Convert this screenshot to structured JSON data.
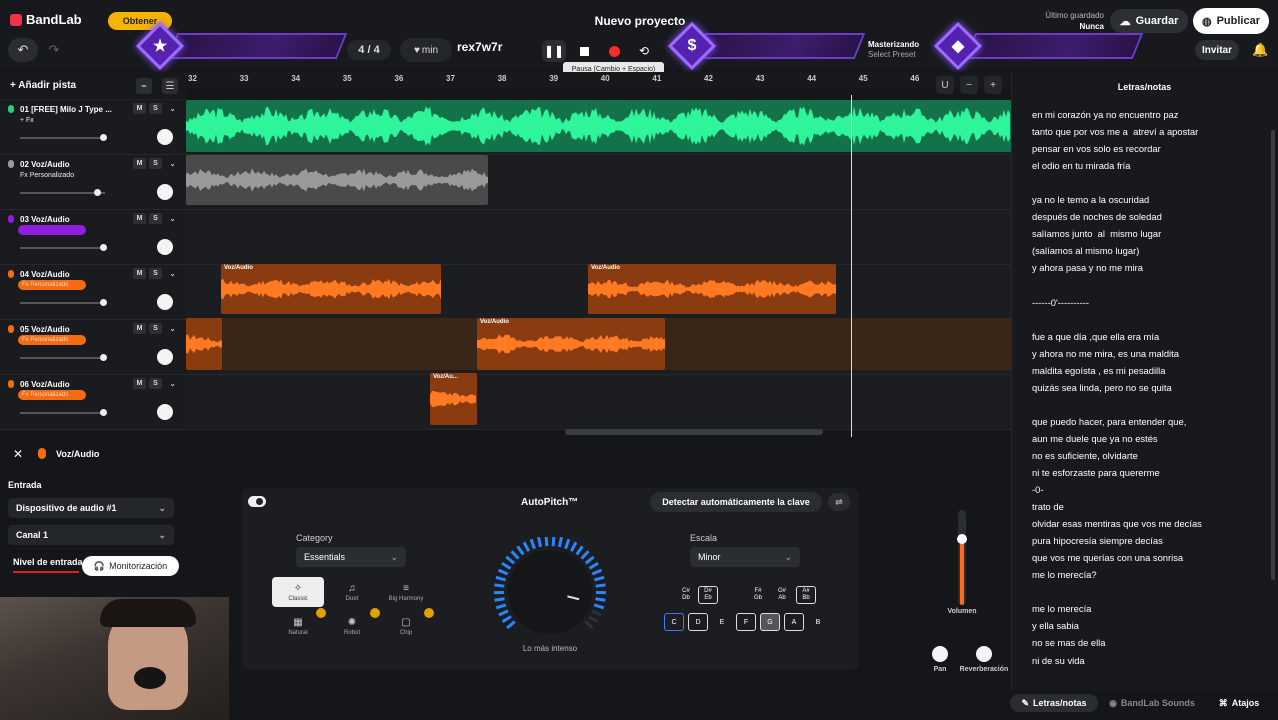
{
  "header": {
    "logo": "BandLab",
    "obtener": "Obtener",
    "project_title": "Nuevo proyecto",
    "saved_label": "Último guardado",
    "saved_value": "Nunca",
    "guardar": "Guardar",
    "publicar": "Publicar",
    "invitar": "Invitar"
  },
  "transport": {
    "time_signature": "4 / 4",
    "tempo_unit": "min",
    "key_name": "rex7w7r",
    "tooltip": "Pausa (Cambio + Espacio)",
    "mastering": "Masterizando",
    "preset": "Select Preset",
    "record_color": "#ff2a2a"
  },
  "tracks_header": {
    "add_track": "Añadir pista"
  },
  "ruler": {
    "bars": [
      "32",
      "33",
      "34",
      "35",
      "36",
      "37",
      "38",
      "39",
      "40",
      "41",
      "42",
      "43",
      "44",
      "45",
      "46"
    ]
  },
  "tracks": [
    {
      "name": "01 [FREE] Milo J Type ...",
      "fx": "+ Fx",
      "color": "#26d07c",
      "fader": 0.98,
      "pill": false
    },
    {
      "name": "02 Voz/Audio",
      "fx": "Fx Personalizado",
      "color": "#9a9a9a",
      "fader": 0.9,
      "pill": false
    },
    {
      "name": "03 Voz/Audio",
      "fx": "",
      "color": "#8e1fe0",
      "fader": 0.98,
      "pill": true
    },
    {
      "name": "04 Voz/Audio",
      "fx": "Fx Personalizado",
      "color": "#f36b12",
      "fader": 0.98,
      "pill": true
    },
    {
      "name": "05 Voz/Audio",
      "fx": "Fx Personalizado",
      "color": "#f36b12",
      "fader": 0.98,
      "pill": true
    },
    {
      "name": "06 Voz/Audio",
      "fx": "Fx Personalizado",
      "color": "#f36b12",
      "fader": 0.98,
      "pill": true
    }
  ],
  "track_buttons": {
    "mute": "M",
    "solo": "S"
  },
  "clips": {
    "label": "Voz/Audio",
    "short_label": "Voz/Au..."
  },
  "lyrics": {
    "title": "Letras/notas",
    "text": "en mi corazón ya no encuentro paz\ntanto que por vos me a  atreví a apostar\npensar en vos solo es recordar\nel odio en tu mirada fría\n\nya no le temo a la oscuridad\ndespués de noches de soledad\nsalíamos junto  al  mismo lugar\n(salíamos al mismo lugar)\ny ahora pasa y no me mira\n\n------0'----------\n\nfue a que día ,que ella era mía\ny ahora no me mira, es una maldita\nmaldita egoísta , es mi pesadilla\nquizás sea linda, pero no se quita\n\nque puedo hacer, para entender que,\naun me duele que ya no estés\nno es suficiente, olvidarte\nni te esforzaste para quererme\n-0-\ntrato de\nolvidar esas mentiras que vos me decías\npura hipocresía siempre decías\nque vos me querías con una sonrisa\nme lo merecía?\n\nme lo merecía\ny ella sabia\nno se mas de ella\nni de su vida"
  },
  "bottom_tabs": {
    "lyrics": "Letras/notas",
    "sounds": "BandLab Sounds",
    "shortcuts": "Atajos"
  },
  "input_panel": {
    "title": "Voz/Audio",
    "input_label": "Entrada",
    "device": "Dispositivo de audio #1",
    "channel": "Canal 1",
    "level_label": "Nivel de entrada",
    "monitor": "Monitorización"
  },
  "autopitch": {
    "title": "AutoPitch™",
    "detect": "Detectar automáticamente la clave",
    "category_label": "Category",
    "category_value": "Essentials",
    "styles": [
      "Classic",
      "Duet",
      "Big Harmony",
      "Natural",
      "Robot",
      "Chip"
    ],
    "dial_label": "Lo más intenso",
    "scale_label": "Escala",
    "scale_value": "Minor",
    "sharps": [
      {
        "top": "C#",
        "bottom": "Db",
        "on": false
      },
      {
        "top": "D#",
        "bottom": "Eb",
        "on": true
      },
      {
        "top": "F#",
        "bottom": "Gb",
        "on": false
      },
      {
        "top": "G#",
        "bottom": "Ab",
        "on": false
      },
      {
        "top": "A#",
        "bottom": "Bb",
        "on": true
      }
    ],
    "naturals": [
      {
        "k": "C",
        "on": true,
        "accent": true
      },
      {
        "k": "D",
        "on": true,
        "accent": false
      },
      {
        "k": "E",
        "on": false,
        "accent": false
      },
      {
        "k": "F",
        "on": true,
        "accent": false
      },
      {
        "k": "G",
        "on": true,
        "accent": false
      },
      {
        "k": "A",
        "on": true,
        "accent": false
      },
      {
        "k": "B",
        "on": false,
        "accent": false
      }
    ],
    "intensity": 0.9,
    "volume_label": "Volumen",
    "volume": 0.7,
    "pan_label": "Pan",
    "reverb_label": "Reverberación"
  }
}
